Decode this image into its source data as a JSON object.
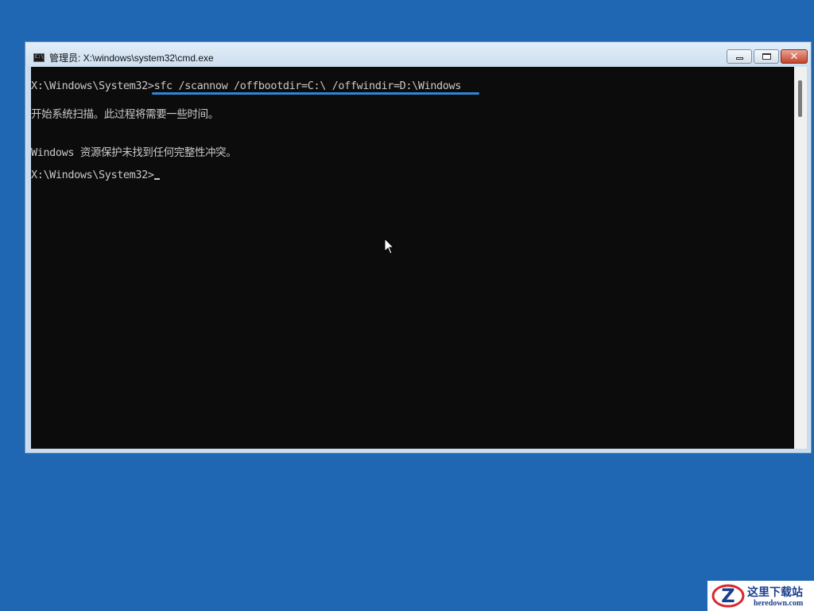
{
  "window": {
    "icon_glyph": "C:\\",
    "title": "管理员: X:\\windows\\system32\\cmd.exe",
    "buttons": {
      "minimize": "minimize-icon",
      "maximize": "maximize-icon",
      "close": "close-icon"
    }
  },
  "console": {
    "lines": [
      {
        "prompt": "X:\\Windows\\System32>",
        "command": "sfc /scannow /offbootdir=C:\\ /offwindir=D:\\Windows"
      },
      {
        "text": "开始系统扫描。此过程将需要一些时间。"
      },
      {
        "text": "Windows 资源保护未找到任何完整性冲突。"
      },
      {
        "prompt": "X:\\Windows\\System32>"
      }
    ],
    "highlight_color": "#2f86d8"
  },
  "watermark": {
    "name": "这里下载站",
    "url": "heredown.com"
  },
  "colors": {
    "desktop": "#1f66b3",
    "console_bg": "#0c0c0c",
    "console_text": "#c8c8c8"
  }
}
